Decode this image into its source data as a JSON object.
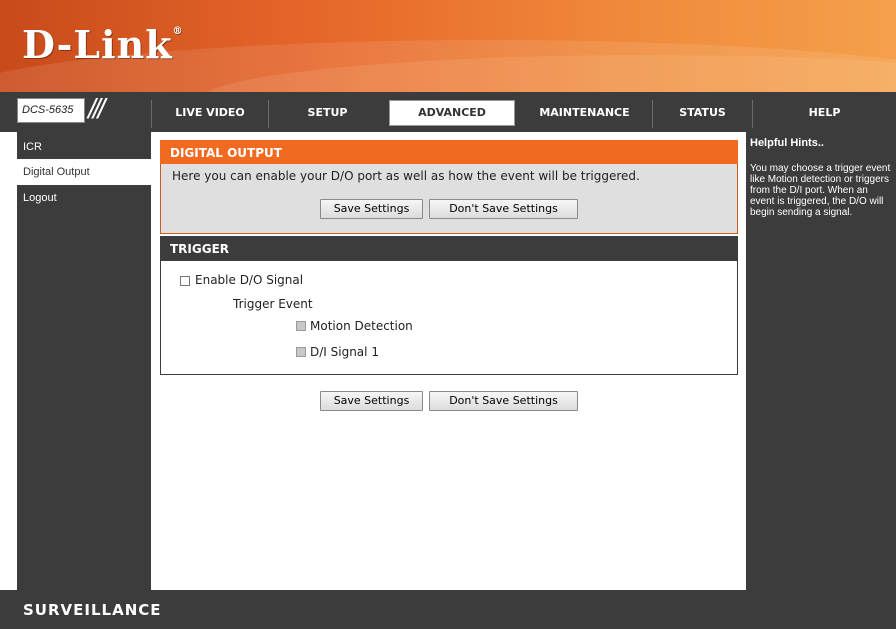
{
  "brand": {
    "logo": "D-Link",
    "registered": "®"
  },
  "model": "DCS-5635",
  "slashes": "///",
  "nav": {
    "tabs": [
      "LIVE VIDEO",
      "SETUP",
      "ADVANCED",
      "MAINTENANCE",
      "STATUS",
      "HELP"
    ],
    "active": "ADVANCED"
  },
  "sidebar": {
    "items": [
      "ICR",
      "Digital Output",
      "Logout"
    ],
    "active": "Digital Output"
  },
  "digital_output": {
    "title": "DIGITAL OUTPUT",
    "description": "Here you can enable your D/O port as well as how the event will be triggered.",
    "save_label": "Save Settings",
    "dont_save_label": "Don't Save Settings"
  },
  "trigger": {
    "title": "TRIGGER",
    "enable_label": "Enable D/O Signal",
    "enable_checked": false,
    "trigger_event_label": "Trigger Event",
    "motion_detection_label": "Motion Detection",
    "di_signal_label": "D/I Signal 1"
  },
  "bottom_buttons": {
    "save_label": "Save Settings",
    "dont_save_label": "Don't Save Settings"
  },
  "help": {
    "title": "Helpful Hints..",
    "text": "You may choose a trigger event like Motion detection or triggers from the D/I port. When an event is triggered, the D/O will begin sending a signal."
  },
  "footer": {
    "text": "SURVEILLANCE"
  },
  "colors": {
    "orange": "#f06a22",
    "dark": "#3c3c3c",
    "panel": "#dfdfdf"
  }
}
